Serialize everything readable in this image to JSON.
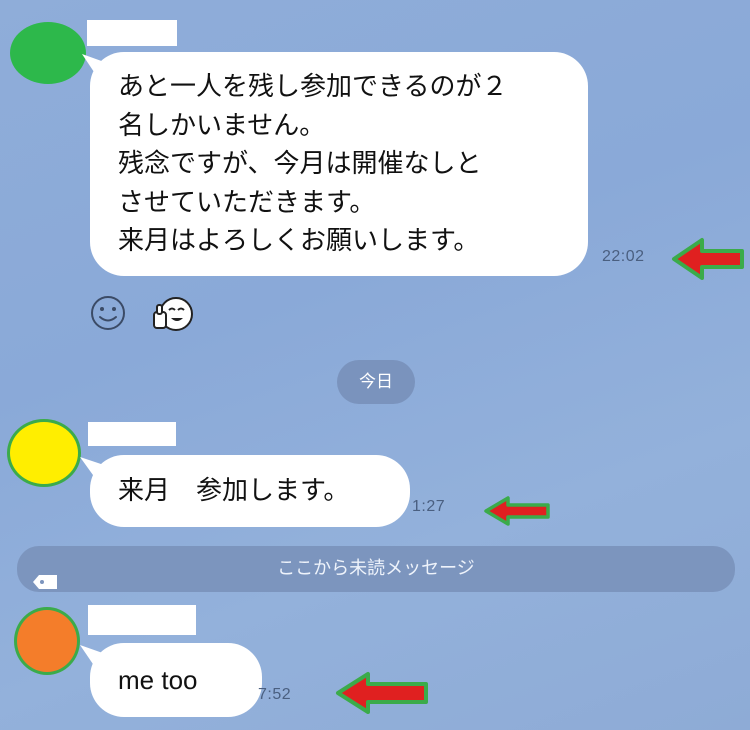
{
  "colors": {
    "background": "#8fadd9",
    "bubble": "#ffffff",
    "timestamp": "#4a5f80",
    "date_pill": "#7a93bd",
    "unread_bar": "#7c95be",
    "arrow_fill": "#e02020",
    "arrow_outline": "#3bab4a"
  },
  "messages": [
    {
      "avatar_color": "#2db84b",
      "text": "あと一人を残し参加できるのが２\n名しかいません。\n残念ですが、今月は開催なしと\nさせていただきます。\n来月はよろしくお願いします。",
      "time": "22:02",
      "reactions": [
        "smiley-icon",
        "thumbs-up-face-icon"
      ]
    },
    {
      "avatar_color": "#ffee00",
      "text": "来月　参加します。",
      "time": "1:27"
    },
    {
      "avatar_color": "#f47d2a",
      "text": "me too",
      "time": "7:52"
    }
  ],
  "date_separator": "今日",
  "unread_divider": {
    "icon": "tag-icon",
    "label": "ここから未読メッセージ"
  }
}
